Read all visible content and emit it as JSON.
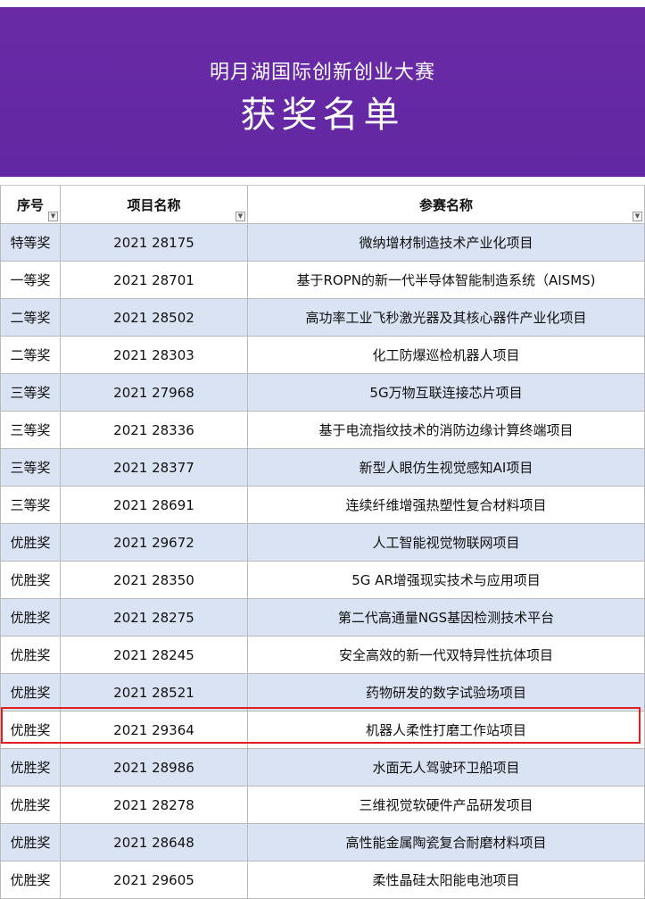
{
  "banner": {
    "subtitle": "明月湖国际创新创业大赛",
    "title": "获奖名单"
  },
  "colors": {
    "banner": "#6227a2",
    "row_stripe": "#dae3f3",
    "highlight": "#e02020"
  },
  "table": {
    "headers": [
      "序号",
      "项目名称",
      "参赛名称"
    ],
    "rows": [
      [
        "特等奖",
        "2021 28175",
        "微纳增材制造技术产业化项目"
      ],
      [
        "一等奖",
        "2021 28701",
        "基于ROPN的新一代半导体智能制造系统（AISMS)"
      ],
      [
        "二等奖",
        "2021 28502",
        "高功率工业飞秒激光器及其核心器件产业化项目"
      ],
      [
        "二等奖",
        "2021 28303",
        "化工防爆巡检机器人项目"
      ],
      [
        "三等奖",
        "2021 27968",
        "5G万物互联连接芯片项目"
      ],
      [
        "三等奖",
        "2021 28336",
        "基于电流指纹技术的消防边缘计算终端项目"
      ],
      [
        "三等奖",
        "2021 28377",
        "新型人眼仿生视觉感知AI项目"
      ],
      [
        "三等奖",
        "2021 28691",
        "连续纤维增强热塑性复合材料项目"
      ],
      [
        "优胜奖",
        "2021 29672",
        "人工智能视觉物联网项目"
      ],
      [
        "优胜奖",
        "2021 28350",
        "5G AR增强现实技术与应用项目"
      ],
      [
        "优胜奖",
        "2021 28275",
        "第二代高通量NGS基因检测技术平台"
      ],
      [
        "优胜奖",
        "2021 28245",
        "安全高效的新一代双特异性抗体项目"
      ],
      [
        "优胜奖",
        "2021 28521",
        "药物研发的数字试验场项目"
      ],
      [
        "优胜奖",
        "2021 29364",
        "机器人柔性打磨工作站项目"
      ],
      [
        "优胜奖",
        "2021 28986",
        "水面无人驾驶环卫船项目"
      ],
      [
        "优胜奖",
        "2021 28278",
        "三维视觉软硬件产品研发项目"
      ],
      [
        "优胜奖",
        "2021 28648",
        "高性能金属陶瓷复合耐磨材料项目"
      ],
      [
        "优胜奖",
        "2021 29605",
        "柔性晶硅太阳能电池项目"
      ]
    ]
  }
}
